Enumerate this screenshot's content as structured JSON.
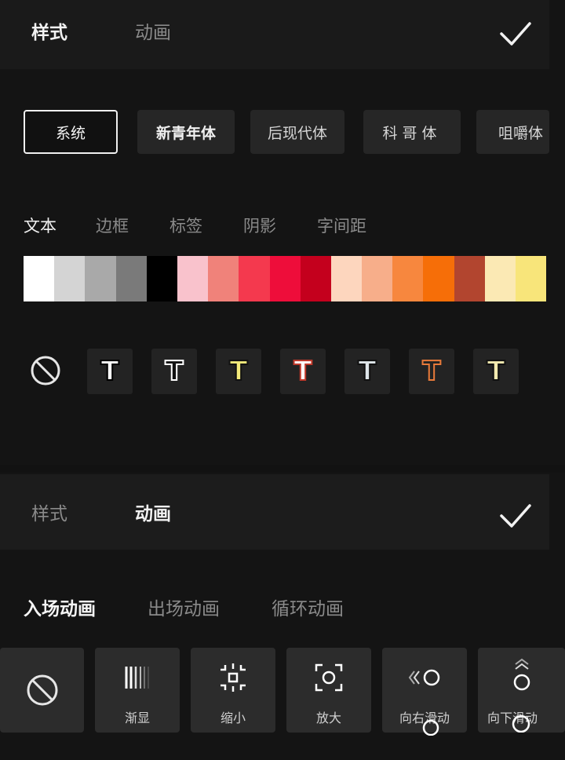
{
  "style_panel": {
    "tabs": [
      {
        "label": "样式"
      },
      {
        "label": "动画"
      }
    ],
    "fonts": [
      {
        "label": "系统"
      },
      {
        "label": "新青年体"
      },
      {
        "label": "后现代体"
      },
      {
        "label": "科哥体"
      },
      {
        "label": "咀嚼体"
      }
    ],
    "subtabs": [
      {
        "label": "文本"
      },
      {
        "label": "边框"
      },
      {
        "label": "标签"
      },
      {
        "label": "阴影"
      },
      {
        "label": "字间距"
      }
    ],
    "palette": [
      "#ffffff",
      "#d4d4d4",
      "#a9a9a9",
      "#7a7a7a",
      "#000000",
      "#f9c2cc",
      "#f0827a",
      "#f4394e",
      "#ee0d3a",
      "#c4001d",
      "#fdd6be",
      "#f7ae8a",
      "#f7873e",
      "#f66e08",
      "#b2452f",
      "#fbe9b4",
      "#f8e57a"
    ],
    "text_styles": [
      {
        "glyph": "T",
        "fill": "#ffffff",
        "stroke": "#000000"
      },
      {
        "glyph": "T",
        "fill": "#111111",
        "stroke": "#ffffff"
      },
      {
        "glyph": "T",
        "fill": "#f3ea7a",
        "stroke": "#111111"
      },
      {
        "glyph": "T",
        "fill": "#ffffff",
        "stroke": "#c0392b"
      },
      {
        "glyph": "T",
        "fill": "#dfe6ea",
        "stroke": "#111111"
      },
      {
        "glyph": "T",
        "fill": "#222222",
        "stroke": "#e87a3a"
      },
      {
        "glyph": "T",
        "fill": "#f3eab0",
        "stroke": "#111111"
      }
    ]
  },
  "anim_panel": {
    "tabs": [
      {
        "label": "样式"
      },
      {
        "label": "动画"
      }
    ],
    "subtabs": [
      {
        "label": "入场动画"
      },
      {
        "label": "出场动画"
      },
      {
        "label": "循环动画"
      }
    ],
    "items": [
      {
        "label": "",
        "icon": "none-icon"
      },
      {
        "label": "渐显",
        "icon": "fade-icon"
      },
      {
        "label": "缩小",
        "icon": "shrink-icon"
      },
      {
        "label": "放大",
        "icon": "zoom-in-icon"
      },
      {
        "label": "向右滑动",
        "icon": "slide-right-icon"
      },
      {
        "label": "向下滑动",
        "icon": "slide-down-icon"
      }
    ]
  }
}
